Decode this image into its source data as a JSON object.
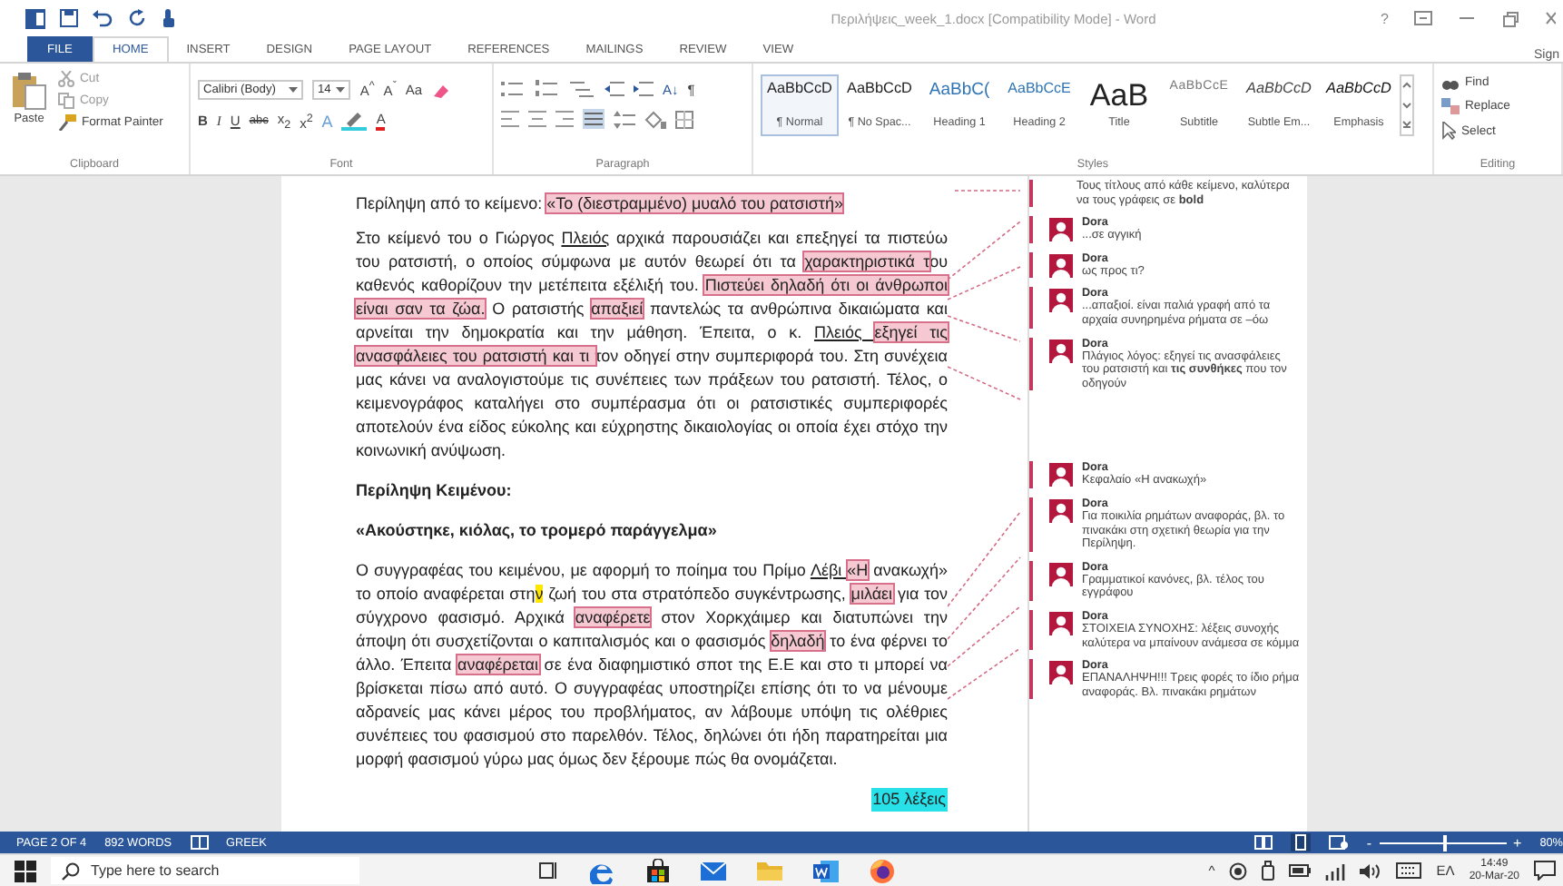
{
  "window": {
    "title": "Περιλήψεις_week_1.docx [Compatibility Mode] - Word",
    "help": "?",
    "sign_in": "Sign"
  },
  "tabs": [
    {
      "label": "FILE",
      "kind": "file",
      "selected": false
    },
    {
      "label": "HOME",
      "kind": "tab",
      "selected": true
    },
    {
      "label": "INSERT",
      "kind": "tab",
      "selected": false
    },
    {
      "label": "DESIGN",
      "kind": "tab",
      "selected": false
    },
    {
      "label": "PAGE LAYOUT",
      "kind": "tab",
      "selected": false
    },
    {
      "label": "REFERENCES",
      "kind": "tab",
      "selected": false
    },
    {
      "label": "MAILINGS",
      "kind": "tab",
      "selected": false
    },
    {
      "label": "REVIEW",
      "kind": "tab",
      "selected": false
    },
    {
      "label": "VIEW",
      "kind": "tab",
      "selected": false
    }
  ],
  "ribbon": {
    "clipboard": {
      "paste": "Paste",
      "cut": "Cut",
      "copy": "Copy",
      "format_painter": "Format Painter",
      "label": "Clipboard"
    },
    "font": {
      "family": "Calibri (Body)",
      "size": "14",
      "row1": [
        {
          "label": "A$^{^}$"
        },
        {
          "label": "A$^{ˇ}$"
        },
        {
          "label": "Aa"
        }
      ],
      "row2": [
        {
          "label": "B",
          "kind": "bold"
        },
        {
          "label": "I",
          "kind": "italic"
        },
        {
          "label": "U",
          "kind": "underline"
        },
        {
          "label": "abc",
          "kind": "strike"
        },
        {
          "label": "x$_{2}$",
          "kind": "plain"
        },
        {
          "label": "x$^{2}$",
          "kind": "plain"
        }
      ],
      "effects": "A",
      "color_letter": "A",
      "label": "Font"
    },
    "paragraph": {
      "pilcrow": "¶",
      "sort": "A↓",
      "label": "Paragraph"
    },
    "styles": {
      "label": "Styles",
      "items": [
        {
          "preview": "AaBbCcD",
          "name": "¶ Normal",
          "kind": "normal",
          "selected": true
        },
        {
          "preview": "AaBbCcD",
          "name": "¶ No Spac...",
          "kind": "normal",
          "selected": false
        },
        {
          "preview": "AaBbC(",
          "name": "Heading 1",
          "kind": "heading1",
          "selected": false
        },
        {
          "preview": "AaBbCcE",
          "name": "Heading 2",
          "kind": "heading2",
          "selected": false
        },
        {
          "preview": "AaB",
          "name": "Title",
          "kind": "title",
          "selected": false
        },
        {
          "preview": "AaBbCcE",
          "name": "Subtitle",
          "kind": "subtitle",
          "selected": false
        },
        {
          "preview": "AaBbCcD",
          "name": "Subtle Em...",
          "kind": "emphasis",
          "selected": false
        },
        {
          "preview": "AaBbCcD",
          "name": "Emphasis",
          "kind": "emphasis_dark",
          "selected": false
        }
      ]
    },
    "editing": {
      "find": "Find",
      "replace": "Replace",
      "select": "Select",
      "label": "Editing"
    }
  },
  "document": {
    "blocks": [
      {
        "kind": "line",
        "segments": [
          {
            "text": "Περίληψη από το κείμενο: ",
            "kind": "plain"
          },
          {
            "text": "«Το (διεστραμμένο) μυαλό του ρατσιστή»",
            "kind": "comment"
          }
        ]
      },
      {
        "kind": "paragraph",
        "segments": [
          {
            "text": "Στο κείμενό του ο Γιώργος ",
            "kind": "plain"
          },
          {
            "text": "Πλειός",
            "kind": "spelling"
          },
          {
            "text": " αρχικά παρουσιάζει και επεξηγεί τα πιστεύω του ρατσιστή, ο οποίος σύμφωνα με αυτόν θεωρεί ότι τα ",
            "kind": "plain"
          },
          {
            "text": "χαρακτηριστικά τ",
            "kind": "comment"
          },
          {
            "text": "ου καθενός καθορίζουν  την μετέπειτα εξέλιξή του. ",
            "kind": "plain"
          },
          {
            "text": "Πιστεύει δηλαδή ότι οι άνθρωποι είναι σαν τα ζώα.",
            "kind": "comment"
          },
          {
            "text": " Ο ρατσιστής ",
            "kind": "plain"
          },
          {
            "text": "απαξιεί",
            "kind": "comment"
          },
          {
            "text": " παντελώς τα ανθρώπινα δικαιώματα και αρνείται την δημοκρατία και την μάθηση. Έπειτα, ο κ. ",
            "kind": "plain"
          },
          {
            "text": "Πλειός ",
            "kind": "spelling"
          },
          {
            "text": "εξηγεί τις ανασφάλειες του ρατσιστή και τι ",
            "kind": "comment"
          },
          {
            "text": "τον οδηγεί στην συμπεριφορά του. Στη συνέχεια μας κάνει να αναλογιστούμε τις συνέπειες των πράξεων του ρατσιστή. Τέλος, ο κειμενογράφος καταλήγει στο συμπέρασμα ότι οι ρατσιστικές συμπεριφορές αποτελούν ένα είδος εύκολης και εύχρηστης δικαιολογίας οι οποία έχει στόχο την κοινωνική ανύψωση.",
            "kind": "plain"
          }
        ]
      },
      {
        "kind": "heading",
        "segments": [
          {
            "text": "Περίληψη Κειμένου:",
            "kind": "plain"
          }
        ]
      },
      {
        "kind": "heading",
        "segments": [
          {
            "text": "«Ακούστηκε, κιόλας, το τρομερό παράγγελμα»",
            "kind": "plain"
          }
        ]
      },
      {
        "kind": "paragraph",
        "segments": [
          {
            "text": "Ο συγγραφέας του κειμένου, με αφορμή το ποίημα του Πρίμο ",
            "kind": "plain"
          },
          {
            "text": "Λέβι ",
            "kind": "spelling"
          },
          {
            "text": "«Η",
            "kind": "comment"
          },
          {
            "text": " ανακωχή» το οποίο αναφέρεται στη",
            "kind": "plain"
          },
          {
            "text": "ν",
            "kind": "cursor"
          },
          {
            "text": " ζωή του στα στρατόπεδο συγκέντρωσης, ",
            "kind": "plain"
          },
          {
            "text": "μιλάει",
            "kind": "comment"
          },
          {
            "text": " για τον σύγχρονο φασισμό. Αρχικά ",
            "kind": "plain"
          },
          {
            "text": "αναφέρετε",
            "kind": "comment"
          },
          {
            "text": " στον Χορκχάιμερ και διατυπώνει την άποψη ότι συσχετίζονται ο καπιταλισμός και ο φασισμός ",
            "kind": "plain"
          },
          {
            "text": "δηλαδή",
            "kind": "comment"
          },
          {
            "text": " το ένα φέρνει το άλλο. Έπειτα ",
            "kind": "plain"
          },
          {
            "text": "αναφέρεται",
            "kind": "comment"
          },
          {
            "text": " σε ένα διαφημιστικό σποτ της Ε.Ε και στο τι μπορεί να βρίσκεται πίσω από αυτό. Ο συγγραφέας υποστηρίζει επίσης ότι το να μένουμε αδρανείς μας κάνει μέρος του προβλήματος, αν λάβουμε υπόψη τις ολέθριες συνέπειες του φασισμού στο παρελθόν. Τέλος, δηλώνει ότι ήδη παρατηρείται μια μορφή φασισμού γύρω μας όμως δεν ξέρουμε πώς θα ονομάζεται.",
            "kind": "plain"
          }
        ]
      },
      {
        "kind": "word_count",
        "text": "105 λέξεις"
      }
    ]
  },
  "comments": [
    {
      "text": "Τους τίτλους από κάθε κείμενο, καλύτερα να τους γράφεις σε **bold**"
    },
    {
      "author": "Dora",
      "text": "...σε αγγική"
    },
    {
      "author": "Dora",
      "text": "ως προς τι?"
    },
    {
      "author": "Dora",
      "text": "...απαξιοί. είναι παλιά γραφή από τα αρχαία συνηρημένα ρήματα σε –όω"
    },
    {
      "author": "Dora",
      "text": "Πλάγιος λόγος: εξηγεί τις ανασφάλειες του ρατσιστή και **τις συνθήκες** που τον οδηγούν"
    },
    {
      "author": "Dora",
      "text": "Κεφαλαίο «Η ανακωχή»"
    },
    {
      "author": "Dora",
      "text": "Για ποικιλία ρημάτων αναφοράς, βλ. το πινακάκι στη σχετική θεωρία για την Περίληψη."
    },
    {
      "author": "Dora",
      "text": "Γραμματικοί κανόνες, βλ. τέλος του εγγράφου"
    },
    {
      "author": "Dora",
      "text": "ΣΤΟΙΧΕΙΑ ΣΥΝΟΧΗΣ: λέξεις συνοχής καλύτερα να μπαίνουν ανάμεσα σε κόμμα"
    },
    {
      "author": "Dora",
      "text": "ΕΠΑΝΑΛΗΨΗ!!! Τρεις φορές το ίδιο ρήμα αναφοράς. Βλ. πινακάκι ρημάτων"
    }
  ],
  "status_bar": {
    "page": "PAGE 2 OF 4",
    "words": "892 WORDS",
    "language": "GREEK",
    "zoom": {
      "zoom_out": "-",
      "zoom_in": "+",
      "level": 0.5,
      "reading": "80%"
    }
  },
  "taskbar": {
    "search_placeholder": "Type here to search",
    "caret": "^",
    "language": "ΕΛ",
    "time": "14:49",
    "date": "20-Mar-20"
  }
}
